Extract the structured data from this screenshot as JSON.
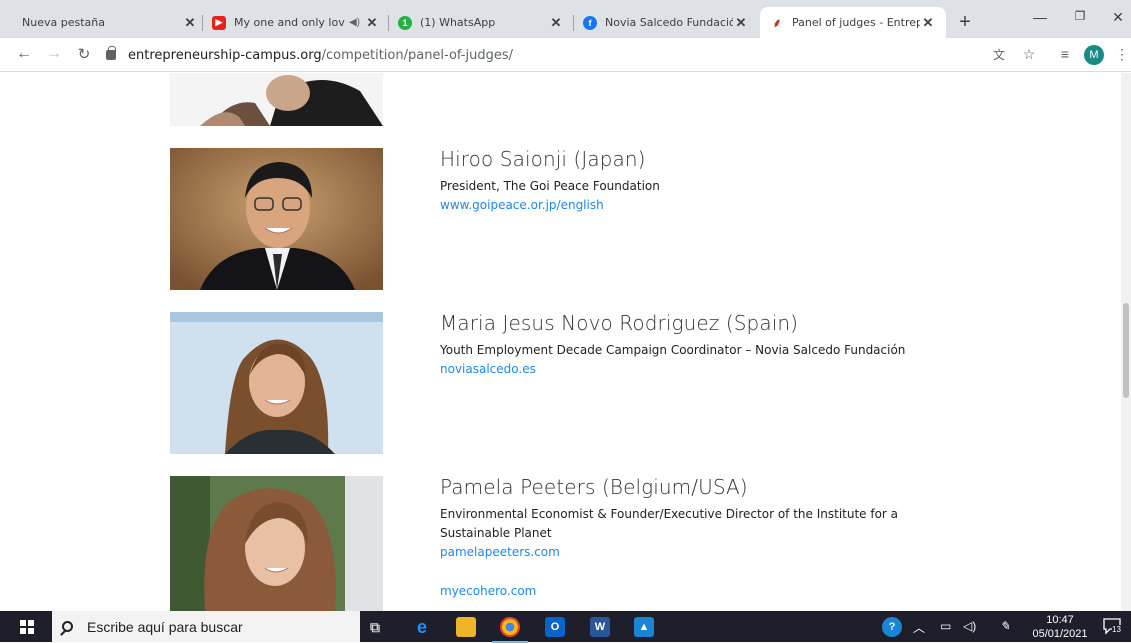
{
  "browser": {
    "tabs": [
      {
        "title": "Nueva pestaña",
        "favicon": "none"
      },
      {
        "title": "My one and only love -",
        "favicon": "youtube-icon",
        "audio": true
      },
      {
        "title": "(1) WhatsApp",
        "favicon": "whatsapp-icon"
      },
      {
        "title": "Novia Salcedo Fundación |",
        "favicon": "facebook-icon"
      },
      {
        "title": "Panel of judges - Entrepren",
        "favicon": "entrepreneurship-campus-icon",
        "active": true
      }
    ],
    "url_host": "entrepreneurship-campus.org",
    "url_path": "/competition/panel-of-judges/",
    "profile_initial": "M"
  },
  "page": {
    "judges": [
      {
        "name": "Hiroo Saionji (Japan)",
        "role": "President, The Goi Peace Foundation",
        "links": [
          "www.goipeace.or.jp/english"
        ]
      },
      {
        "name": "Maria Jesus Novo Rodriguez (Spain)",
        "role": "Youth Employment Decade Campaign Coordinator – Novia Salcedo Fundación",
        "links": [
          "noviasalcedo.es"
        ]
      },
      {
        "name": "Pamela Peeters (Belgium/USA)",
        "role": "Environmental Economist & Founder/Executive Director of the Institute for a Sustainable Planet",
        "links": [
          "pamelapeeters.com",
          "myecohero.com"
        ]
      }
    ]
  },
  "taskbar": {
    "search_placeholder": "Escribe aquí para buscar",
    "time": "10:47",
    "date": "05/01/2021",
    "notification_count": "13"
  },
  "colors": {
    "link": "#1e88e5",
    "taskbar": "#1f1f2b",
    "tabstrip": "#dee1e6"
  }
}
